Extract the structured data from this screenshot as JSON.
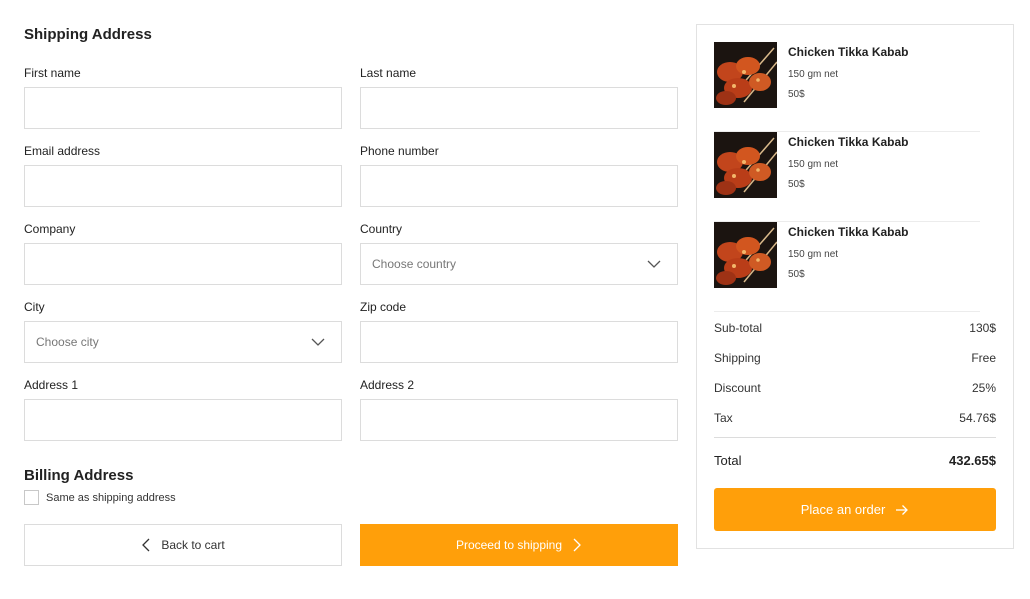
{
  "shipping": {
    "title": "Shipping Address",
    "first_name": {
      "label": "First name",
      "value": ""
    },
    "last_name": {
      "label": "Last name",
      "value": ""
    },
    "email": {
      "label": "Email address",
      "value": ""
    },
    "phone": {
      "label": "Phone number",
      "value": ""
    },
    "company": {
      "label": "Company",
      "value": ""
    },
    "country": {
      "label": "Country",
      "placeholder": "Choose country"
    },
    "city": {
      "label": "City",
      "placeholder": "Choose city"
    },
    "zip": {
      "label": "Zip code",
      "value": ""
    },
    "address1": {
      "label": "Address 1",
      "value": ""
    },
    "address2": {
      "label": "Address 2",
      "value": ""
    }
  },
  "billing": {
    "title": "Billing Address",
    "same_as_shipping_label": "Same as shipping address",
    "same_as_shipping_checked": false
  },
  "actions": {
    "back_label": "Back to cart",
    "proceed_label": "Proceed to shipping"
  },
  "order": {
    "items": [
      {
        "name": "Chicken Tikka Kabab",
        "weight": "150 gm net",
        "price": "50$"
      },
      {
        "name": "Chicken Tikka Kabab",
        "weight": "150 gm net",
        "price": "50$"
      },
      {
        "name": "Chicken Tikka Kabab",
        "weight": "150 gm net",
        "price": "50$"
      }
    ],
    "subtotal": {
      "label": "Sub-total",
      "value": "130$"
    },
    "shipping": {
      "label": "Shipping",
      "value": "Free"
    },
    "discount": {
      "label": "Discount",
      "value": "25%"
    },
    "tax": {
      "label": "Tax",
      "value": "54.76$"
    },
    "total": {
      "label": "Total",
      "value": "432.65$"
    },
    "place_order_label": "Place an order"
  },
  "colors": {
    "accent": "#ff9f0a",
    "border": "#dcdcdc"
  },
  "icons": [
    "chevron-down-icon",
    "chevron-left-icon",
    "chevron-right-icon",
    "arrow-right-icon"
  ]
}
